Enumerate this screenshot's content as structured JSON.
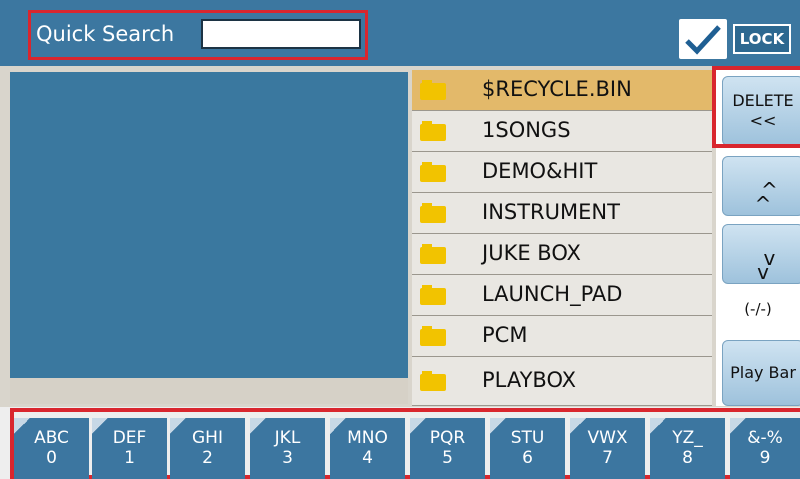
{
  "header": {
    "search_label": "Quick Search",
    "search_value": "",
    "lock_label": "LOCK",
    "lock_checked": true
  },
  "files": [
    {
      "name": "$RECYCLE.BIN",
      "icon": "folder-icon",
      "selected": true
    },
    {
      "name": "1SONGS",
      "icon": "folder-icon"
    },
    {
      "name": "DEMO&HIT",
      "icon": "folder-icon"
    },
    {
      "name": "INSTRUMENT",
      "icon": "folder-icon"
    },
    {
      "name": "JUKE BOX",
      "icon": "folder-icon"
    },
    {
      "name": "LAUNCH_PAD",
      "icon": "folder-icon"
    },
    {
      "name": "PCM",
      "icon": "folder-icon"
    },
    {
      "name": "PLAYBOX",
      "icon": "folder-icon"
    }
  ],
  "side": {
    "delete_label": "DELETE",
    "delete_sub": "<<",
    "up_label": "^\n^",
    "down_label": "v\nv",
    "page_indicator": "(-/-)",
    "play_label": "Play Bar"
  },
  "keys": [
    {
      "letters": "ABC",
      "digit": "0"
    },
    {
      "letters": "DEF",
      "digit": "1"
    },
    {
      "letters": "GHI",
      "digit": "2"
    },
    {
      "letters": "JKL",
      "digit": "3"
    },
    {
      "letters": "MNO",
      "digit": "4"
    },
    {
      "letters": "PQR",
      "digit": "5"
    },
    {
      "letters": "STU",
      "digit": "6"
    },
    {
      "letters": "VWX",
      "digit": "7"
    },
    {
      "letters": "YZ_",
      "digit": "8"
    },
    {
      "letters": "&-%",
      "digit": "9"
    }
  ],
  "colors": {
    "accent_blue": "#3c77a0",
    "highlight_red": "#d9262e",
    "selected_row": "#e3b96a"
  }
}
